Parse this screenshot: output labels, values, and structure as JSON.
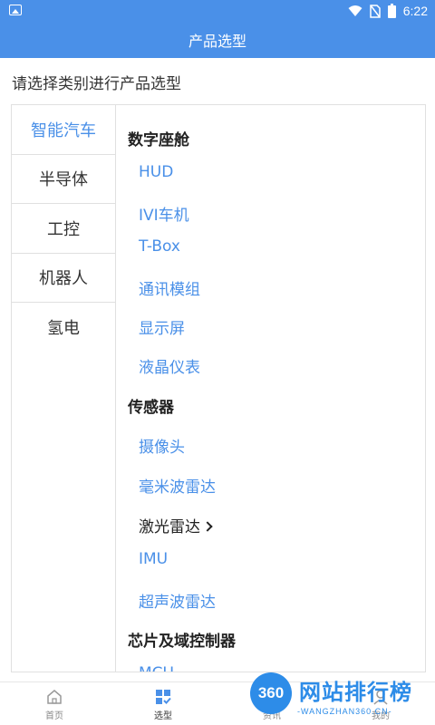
{
  "status_bar": {
    "time": "6:22"
  },
  "header": {
    "title": "产品选型"
  },
  "subtitle": "请选择类别进行产品选型",
  "categories": [
    {
      "label": "智能汽车",
      "active": true
    },
    {
      "label": "半导体",
      "active": false
    },
    {
      "label": "工控",
      "active": false
    },
    {
      "label": "机器人",
      "active": false
    },
    {
      "label": "氢电",
      "active": false
    }
  ],
  "groups": [
    {
      "title": "数字座舱",
      "items": [
        "HUD",
        "IVI车机",
        "T-Box",
        "通讯模组",
        "显示屏",
        "液晶仪表"
      ]
    },
    {
      "title": "传感器",
      "items": [
        "摄像头",
        "毫米波雷达",
        "激光雷达",
        "IMU",
        "超声波雷达"
      ]
    },
    {
      "title": "芯片及域控制器",
      "items": [
        "MCU"
      ]
    }
  ],
  "tabs": [
    {
      "label": "首页",
      "icon": "home-icon"
    },
    {
      "label": "选型",
      "icon": "selection-icon",
      "active": true
    },
    {
      "label": "资讯",
      "icon": "news-icon"
    },
    {
      "label": "我的",
      "icon": "user-icon"
    }
  ],
  "watermark": {
    "badge": "360",
    "text": "网站排行榜",
    "url": "-WANGZHAN360.CN-"
  },
  "colors": {
    "primary": "#4a90e8",
    "watermark": "#2d8ce8"
  }
}
